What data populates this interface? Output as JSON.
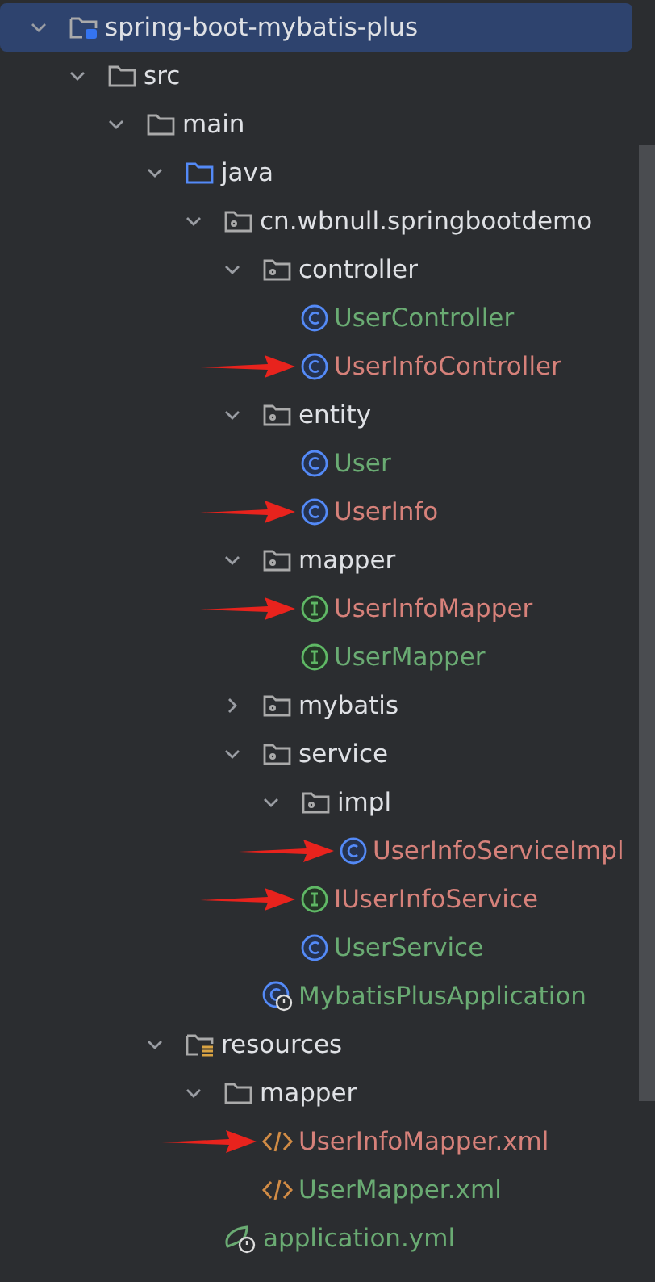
{
  "tree": [
    {
      "label": "spring-boot-mybatis-plus",
      "kind": "project",
      "expanded": true,
      "selected": true,
      "children": [
        {
          "label": "src",
          "kind": "folder",
          "expanded": true,
          "selected": false,
          "children": [
            {
              "label": "main",
              "kind": "folder",
              "expanded": true,
              "selected": false,
              "children": [
                {
                  "label": "java",
                  "kind": "source-folder",
                  "expanded": true,
                  "selected": false,
                  "children": [
                    {
                      "label": "cn.wbnull.springbootdemo",
                      "kind": "package",
                      "expanded": true,
                      "selected": false,
                      "children": [
                        {
                          "label": "controller",
                          "kind": "package",
                          "expanded": true,
                          "selected": false,
                          "children": [
                            {
                              "label": "UserController",
                              "kind": "class",
                              "color": "#6aab73",
                              "selected": false
                            },
                            {
                              "label": "UserInfoController",
                              "kind": "class",
                              "color": "#d6817a",
                              "selected": false,
                              "marked": true
                            }
                          ]
                        },
                        {
                          "label": "entity",
                          "kind": "package",
                          "expanded": true,
                          "selected": false,
                          "children": [
                            {
                              "label": "User",
                              "kind": "class",
                              "color": "#6aab73",
                              "selected": false
                            },
                            {
                              "label": "UserInfo",
                              "kind": "class",
                              "color": "#d6817a",
                              "selected": false,
                              "marked": true
                            }
                          ]
                        },
                        {
                          "label": "mapper",
                          "kind": "package",
                          "expanded": true,
                          "selected": false,
                          "children": [
                            {
                              "label": "UserInfoMapper",
                              "kind": "interface",
                              "color": "#d6817a",
                              "selected": false,
                              "marked": true
                            },
                            {
                              "label": "UserMapper",
                              "kind": "interface",
                              "color": "#6aab73",
                              "selected": false
                            }
                          ]
                        },
                        {
                          "label": "mybatis",
                          "kind": "package",
                          "expanded": false,
                          "selected": false
                        },
                        {
                          "label": "service",
                          "kind": "package",
                          "expanded": true,
                          "selected": false,
                          "children": [
                            {
                              "label": "impl",
                              "kind": "package",
                              "expanded": true,
                              "selected": false,
                              "children": [
                                {
                                  "label": "UserInfoServiceImpl",
                                  "kind": "class",
                                  "color": "#d6817a",
                                  "selected": false,
                                  "marked": true
                                }
                              ]
                            },
                            {
                              "label": "IUserInfoService",
                              "kind": "interface",
                              "color": "#d6817a",
                              "selected": false,
                              "marked": true
                            },
                            {
                              "label": "UserService",
                              "kind": "class",
                              "color": "#6aab73",
                              "selected": false
                            }
                          ]
                        },
                        {
                          "label": "MybatisPlusApplication",
                          "kind": "boot-class",
                          "color": "#6aab73",
                          "selected": false
                        }
                      ]
                    }
                  ]
                },
                {
                  "label": "resources",
                  "kind": "resources-folder",
                  "expanded": true,
                  "selected": false,
                  "children": [
                    {
                      "label": "mapper",
                      "kind": "folder",
                      "expanded": true,
                      "selected": false,
                      "children": [
                        {
                          "label": "UserInfoMapper.xml",
                          "kind": "xml",
                          "color": "#d6817a",
                          "selected": false,
                          "marked": true
                        },
                        {
                          "label": "UserMapper.xml",
                          "kind": "xml",
                          "color": "#6aab73",
                          "selected": false
                        }
                      ]
                    },
                    {
                      "label": "application.yml",
                      "kind": "yml",
                      "color": "#6aab73",
                      "selected": false
                    }
                  ]
                }
              ]
            }
          ]
        }
      ]
    }
  ]
}
